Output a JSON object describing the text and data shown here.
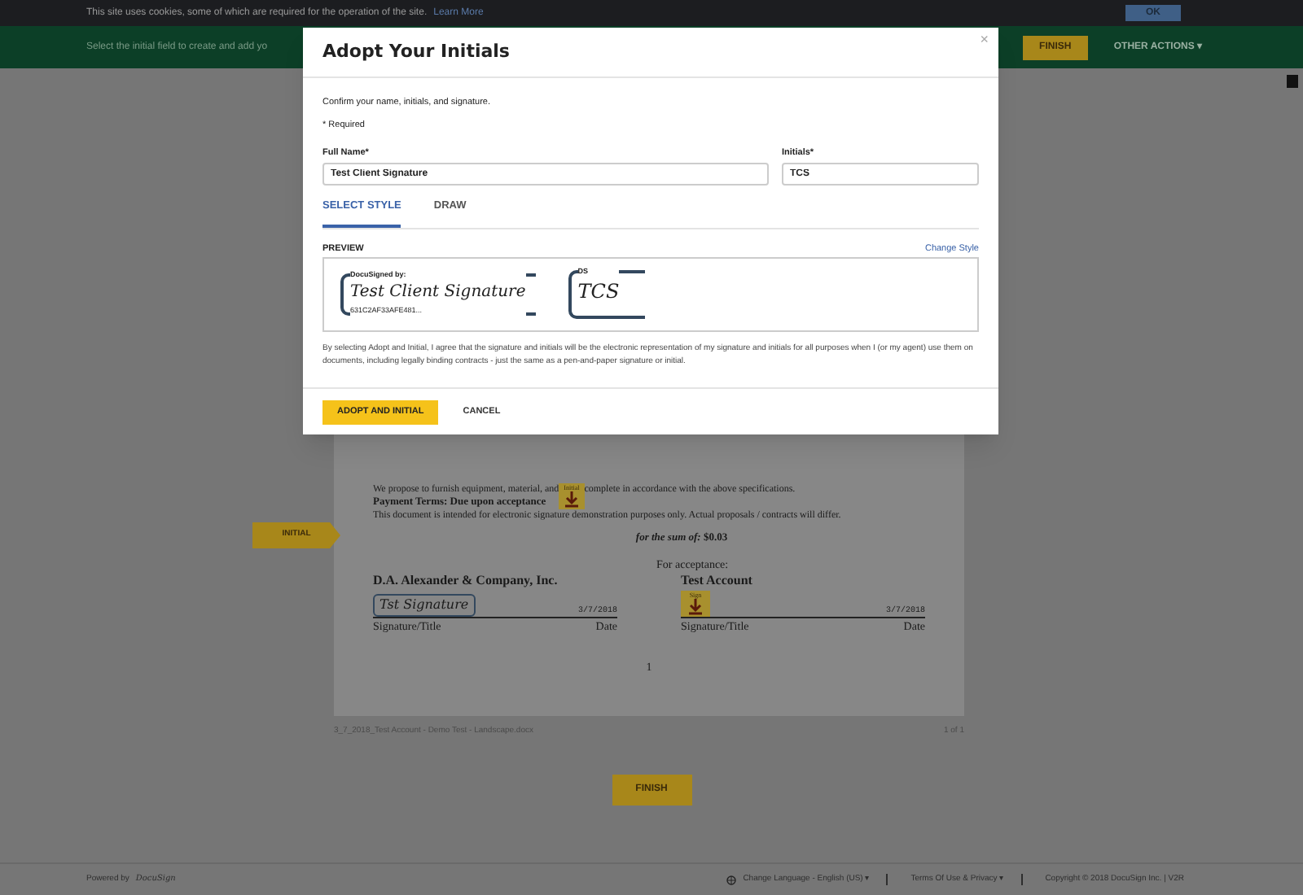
{
  "cookie_bar": {
    "text": "This site uses cookies, some of which are required for the operation of the site.",
    "link": "Learn More",
    "button": "OK"
  },
  "action_bar": {
    "message": "Select the initial field to create and add yo",
    "finish": "FINISH",
    "other_actions": "OTHER ACTIONS ▾"
  },
  "document": {
    "initial_tag": "INITIAL",
    "lines": [
      "We propose to furnish equipment, material, and",
      "complete in accordance with the above specifications."
    ],
    "payment": "Payment Terms: Due upon acceptance",
    "notice": "This document is intended for electronic signature demonstration purposes only. Actual proposals / contracts will differ.",
    "sum": "*for the sum of:* **$0.03**",
    "initial_stamp": "Initial",
    "for_acceptance": "For acceptance:",
    "signers": [
      {
        "name": "D.A. Alexander & Company, Inc.",
        "signature": "Tst Signature",
        "signed": true,
        "date": "3/7/2018",
        "label": "Signature/Title",
        "date_label": "Date"
      },
      {
        "name": "Test Account",
        "signature": "Sign",
        "signed": false,
        "date": "3/7/2018",
        "label": "Signature/Title",
        "date_label": "Date"
      }
    ],
    "page_number": "1",
    "file_name": "3_7_2018_Test Account - Demo Test - Landscape.docx",
    "page_count": "1 of 1"
  },
  "finish_button": "FINISH",
  "footer": {
    "powered_by": "Powered by",
    "brand": "DocuSign",
    "language": "Change Language - English (US) ▾",
    "terms": "Terms Of Use & Privacy ▾",
    "copyright": "Copyright © 2018 DocuSign Inc. | V2R"
  },
  "dialog": {
    "title": "Adopt Your Initials",
    "close": "×",
    "intro": "Confirm your name, initials, and signature.",
    "required": "* Required",
    "fields": [
      {
        "label": "Full Name*",
        "value": "Test Client Signature"
      },
      {
        "label": "Initials*",
        "value": "TCS"
      }
    ],
    "tabs": [
      {
        "label": "SELECT STYLE",
        "selected": true
      },
      {
        "label": "DRAW",
        "selected": false
      }
    ],
    "preview_label": "PREVIEW",
    "change_style": "Change Style",
    "preview": {
      "signature_caption": "DocuSigned by:",
      "signature": "Test Client Signature",
      "hash": "631C2AF33AFE481...",
      "initials_caption": "DS",
      "initials": "TCS"
    },
    "legal": "By selecting Adopt and Initial, I agree that the signature and initials will be the electronic representation of my signature and initials for all purposes when I (or my agent) use them on documents, including legally binding contracts - just the same as a pen-and-paper signature or initial.",
    "buttons": [
      {
        "kind": "primary",
        "label": "ADOPT AND INITIAL"
      },
      {
        "kind": "secondary",
        "label": "CANCEL"
      }
    ]
  }
}
